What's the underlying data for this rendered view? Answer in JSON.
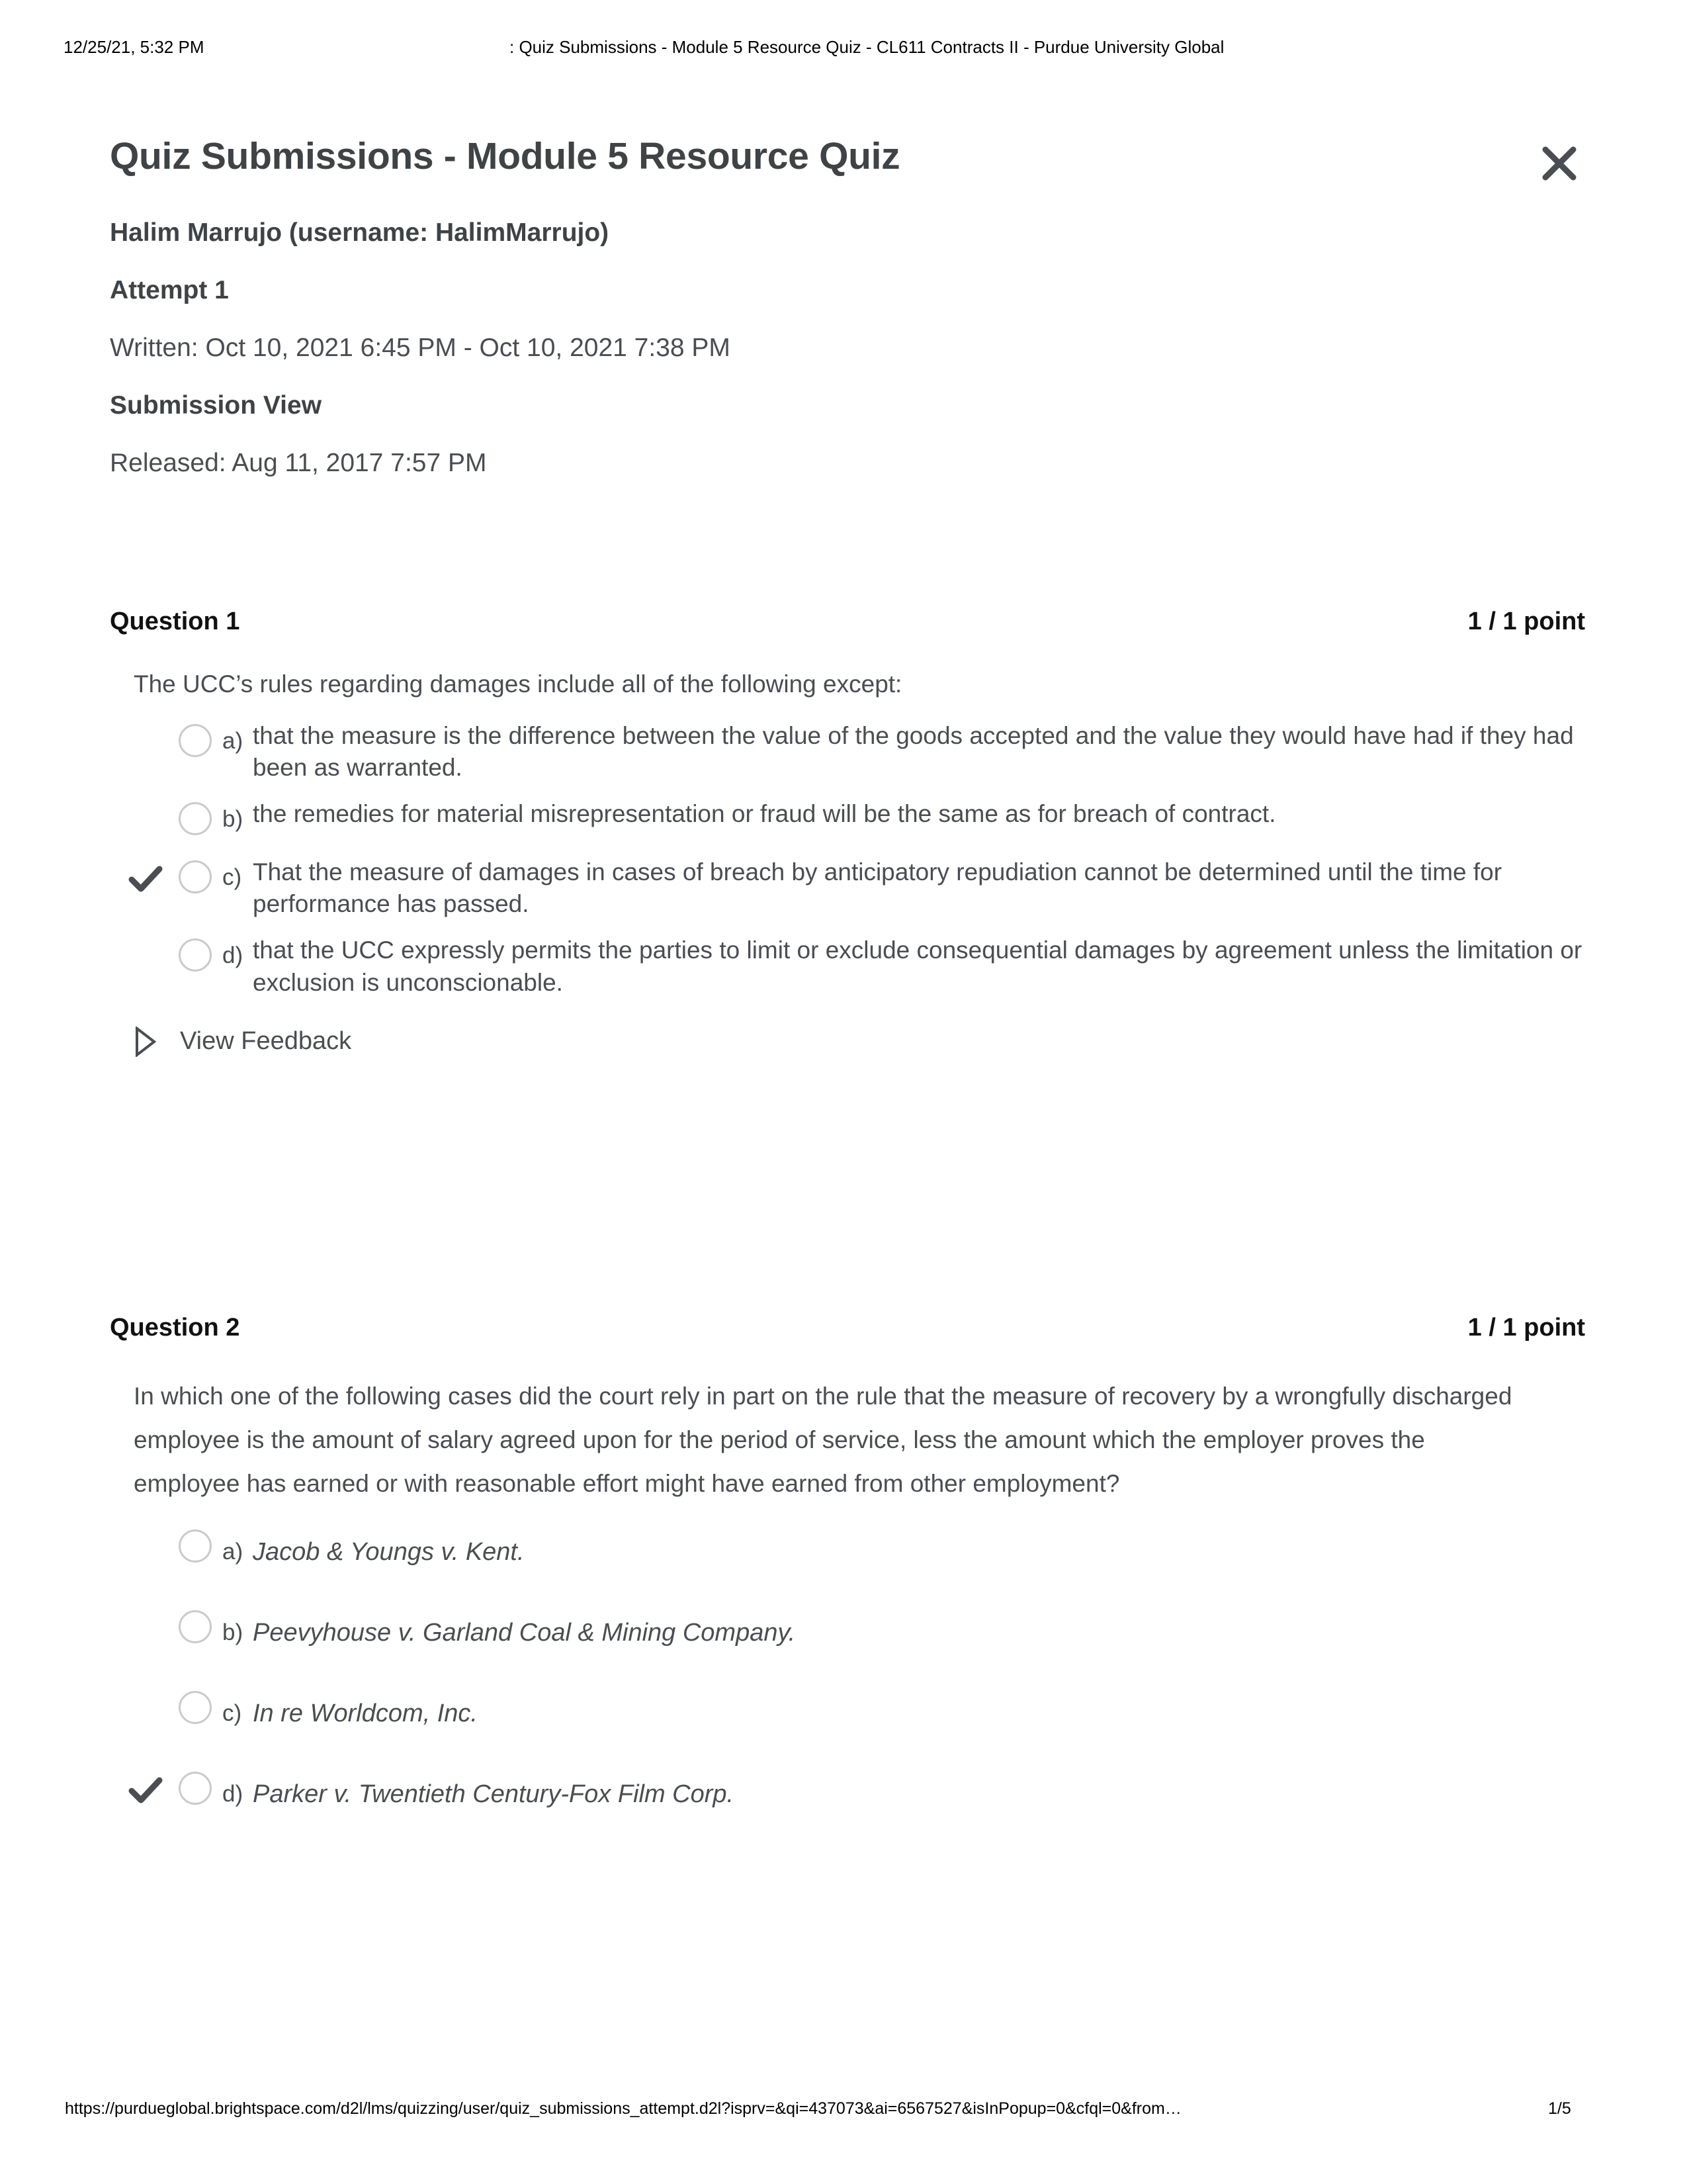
{
  "print_header": {
    "date": "12/25/21, 5:32 PM",
    "title": ": Quiz Submissions - Module 5 Resource Quiz - CL611 Contracts II - Purdue University Global"
  },
  "print_footer": {
    "url": "https://purdueglobal.brightspace.com/d2l/lms/quizzing/user/quiz_submissions_attempt.d2l?isprv=&qi=437073&ai=6567527&isInPopup=0&cfql=0&from…",
    "page": "1/5"
  },
  "header": {
    "title": "Quiz Submissions - Module 5 Resource Quiz",
    "close_icon": "close-icon"
  },
  "meta": {
    "user": "Halim Marrujo (username: HalimMarrujo)",
    "attempt": "Attempt 1",
    "written": "Written: Oct 10, 2021 6:45 PM - Oct 10, 2021 7:38 PM",
    "submission_view": "Submission View",
    "released": "Released: Aug 11, 2017 7:57 PM"
  },
  "colors": {
    "body_text": "#4a4d52",
    "heading_text": "#111111",
    "title_text": "#3f4346",
    "radio_border": "#c9cbcd",
    "check_mark": "#4a4d52",
    "page_background": "#ffffff"
  },
  "questions": [
    {
      "label": "Question 1",
      "points": "1 / 1 point",
      "stem": "The UCC’s rules regarding damages include all of the following except:",
      "options": [
        {
          "letter": "a)",
          "text": "that the measure is the difference between the value of the goods accepted and the value they would have had if they had been as warranted.",
          "selected": false,
          "italic": false
        },
        {
          "letter": "b)",
          "text": "the remedies for material misrepresentation or fraud will be the same as for breach of contract.",
          "selected": false,
          "italic": false
        },
        {
          "letter": "c)",
          "text": "That the measure of damages in cases of breach by anticipatory repudiation cannot be determined until the time for performance has passed.",
          "selected": true,
          "italic": false
        },
        {
          "letter": "d)",
          "text": "that the UCC expressly permits the parties to limit or exclude consequential damages by agreement unless the limitation or exclusion is unconscionable.",
          "selected": false,
          "italic": false
        }
      ],
      "feedback_label": "View Feedback",
      "feedback_icon": "caret-right-icon"
    },
    {
      "label": "Question 2",
      "points": "1 / 1 point",
      "stem": "In which one of the following cases did the court rely in part on the rule that the measure of recovery by a wrongfully discharged employee is the amount of salary agreed upon for the period of service, less the amount which the employer proves the employee has earned or with reasonable effort might have earned from other employment?",
      "options": [
        {
          "letter": "a)",
          "text": "Jacob & Youngs v. Kent.",
          "selected": false,
          "italic": true
        },
        {
          "letter": "b)",
          "text": "Peevyhouse v. Garland Coal & Mining Company.",
          "selected": false,
          "italic": true
        },
        {
          "letter": "c)",
          "text": "In re Worldcom, Inc.",
          "selected": false,
          "italic": true
        },
        {
          "letter": "d)",
          "text": "Parker v. Twentieth Century-Fox Film Corp.",
          "selected": true,
          "italic": true
        }
      ]
    }
  ]
}
